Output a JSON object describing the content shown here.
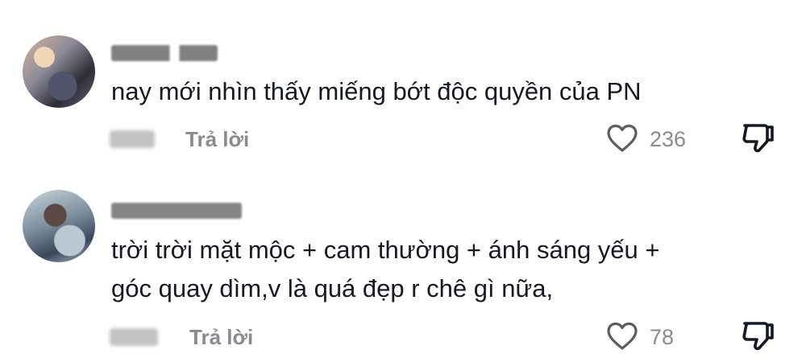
{
  "comments": [
    {
      "text_lines": [
        "nay mới nhìn thấy miếng bớt độc quyền của PN"
      ],
      "reply_label": "Trả lời",
      "like_count": "236",
      "icons": {
        "like": "heart-icon",
        "dislike": "thumbs-down-icon"
      }
    },
    {
      "text_lines": [
        "trời trời mặt mộc + cam thường + ánh sáng yếu +",
        "góc quay dìm,v là quá đẹp r chê gì nữa,"
      ],
      "reply_label": "Trả lời",
      "like_count": "78",
      "icons": {
        "like": "heart-icon",
        "dislike": "thumbs-down-icon"
      }
    }
  ],
  "colors": {
    "text": "#161823",
    "secondary_text": "#8a8b91",
    "background": "#ffffff"
  }
}
